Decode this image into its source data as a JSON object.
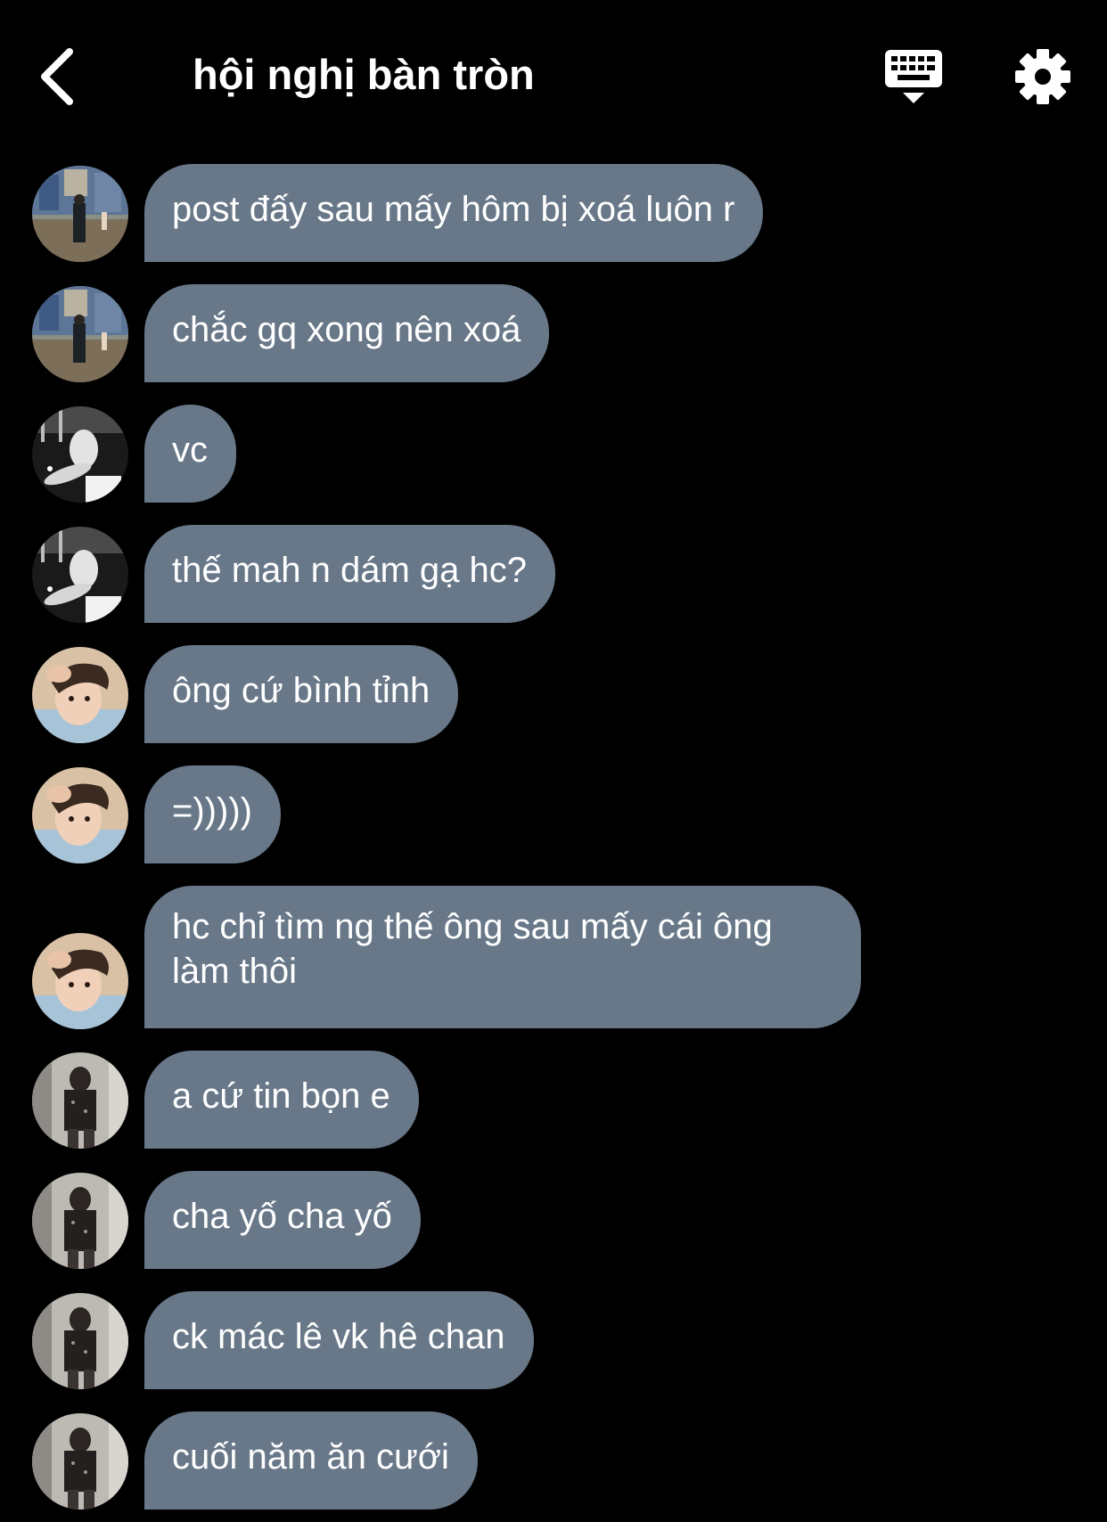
{
  "header": {
    "title": "hội nghị bàn tròn",
    "back_icon": "chevron-left-icon",
    "keyboard_icon": "keyboard-hide-icon",
    "settings_icon": "gear-icon"
  },
  "colors": {
    "background": "#000000",
    "bubble": "#687889",
    "text": "#ffffff"
  },
  "messages": [
    {
      "sender": "user-1",
      "text": "post đấy sau mấy hôm bị xoá luôn r"
    },
    {
      "sender": "user-1",
      "text": "chắc gq xong nên xoá"
    },
    {
      "sender": "user-2",
      "text": "vc"
    },
    {
      "sender": "user-2",
      "text": "thế mah n dám gạ hc?"
    },
    {
      "sender": "user-3",
      "text": "ông cứ bình tỉnh"
    },
    {
      "sender": "user-3",
      "text": "=)))))"
    },
    {
      "sender": "user-3",
      "text": "hc chỉ tìm ng thế ông sau mấy cái ông làm thôi"
    },
    {
      "sender": "user-4",
      "text": "a cứ tin bọn e"
    },
    {
      "sender": "user-4",
      "text": "cha yố cha yố"
    },
    {
      "sender": "user-4",
      "text": "ck mác lê vk hê chan"
    },
    {
      "sender": "user-4",
      "text": "cuối năm ăn cưới"
    }
  ]
}
